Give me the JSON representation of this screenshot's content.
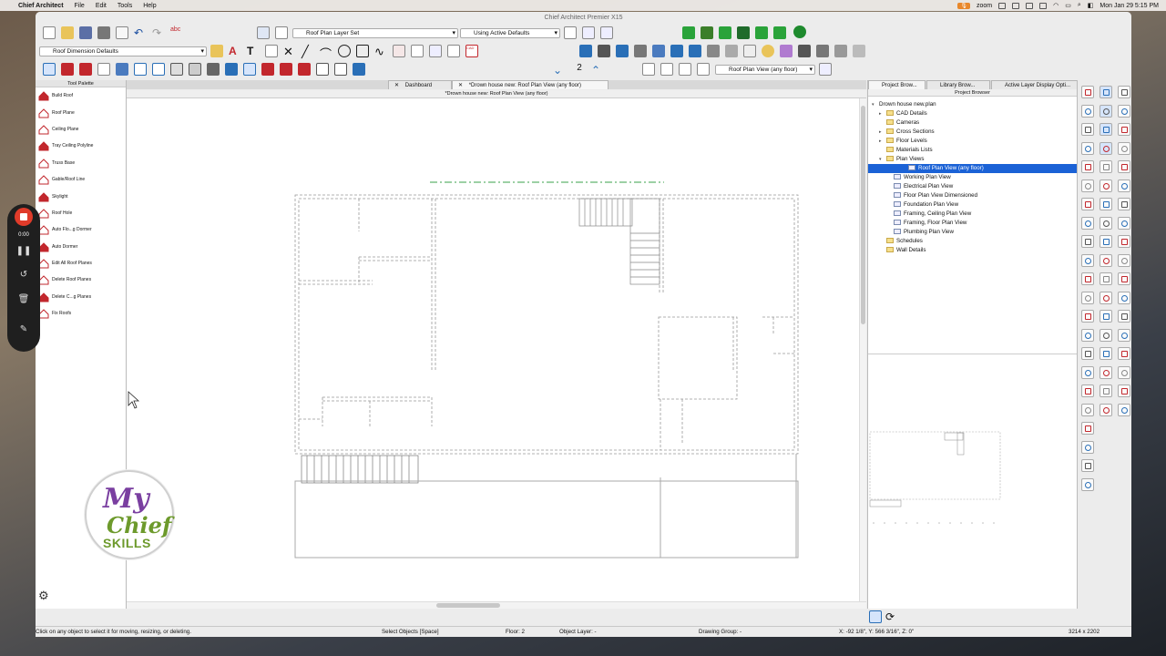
{
  "menubar": {
    "app_name": "Chief Architect",
    "menus": [
      "File",
      "Edit",
      "Tools",
      "Help"
    ],
    "zoom_label": "zoom",
    "clock": "Mon Jan 29  5:15 PM"
  },
  "window": {
    "title": "Chief Architect Premier X15"
  },
  "toolbar": {
    "layer_set": "Roof Plan Layer Set",
    "defaults_mode": "Using Active Defaults",
    "dimension_defaults": "Roof Dimension Defaults",
    "floor_number": "2",
    "view_select": "Roof Plan View (any floor)"
  },
  "palette": {
    "title": "Tool Palette",
    "items": [
      {
        "label": "Build Roof",
        "icon": "build-roof-icon"
      },
      {
        "label": "Roof Plane",
        "icon": "roof-plane-icon"
      },
      {
        "label": "Ceiling Plane",
        "icon": "ceiling-plane-icon"
      },
      {
        "label": "Tray Ceiling Polyline",
        "icon": "tray-ceiling-icon"
      },
      {
        "label": "Truss Base",
        "icon": "truss-base-icon"
      },
      {
        "label": "Gable/Roof Line",
        "icon": "gable-line-icon"
      },
      {
        "label": "Skylight",
        "icon": "skylight-icon"
      },
      {
        "label": "Roof Hole",
        "icon": "roof-hole-icon"
      },
      {
        "label": "Auto Flo...g Dormer",
        "icon": "floating-dormer-icon"
      },
      {
        "label": "Auto Dormer",
        "icon": "auto-dormer-icon"
      },
      {
        "label": "Edit All Roof Planes",
        "icon": "edit-roof-planes-icon"
      },
      {
        "label": "Delete Roof Planes",
        "icon": "delete-roof-planes-icon"
      },
      {
        "label": "Delete C...g Planes",
        "icon": "delete-ceiling-planes-icon"
      },
      {
        "label": "Fix Roofs",
        "icon": "fix-roofs-icon"
      }
    ]
  },
  "tabs": [
    {
      "label": "Dashboard"
    },
    {
      "label": "*Drown house new:  Roof Plan View (any floor)"
    }
  ],
  "view_header": "*Drown house new:  Roof Plan View (any floor)",
  "right_tabs": [
    {
      "label": "Project Brow..."
    },
    {
      "label": "Library Brow..."
    },
    {
      "label": "Active Layer Display Opti..."
    }
  ],
  "project_browser": {
    "title": "Project Browser",
    "root": "Drown house new.plan",
    "nodes": [
      {
        "label": "CAD Details",
        "level": 1,
        "type": "folder",
        "twisty": "▸"
      },
      {
        "label": "Cameras",
        "level": 1,
        "type": "folder",
        "twisty": ""
      },
      {
        "label": "Cross Sections",
        "level": 1,
        "type": "folder",
        "twisty": "▸"
      },
      {
        "label": "Floor Levels",
        "level": 1,
        "type": "folder",
        "twisty": "▸"
      },
      {
        "label": "Materials Lists",
        "level": 1,
        "type": "folder",
        "twisty": ""
      },
      {
        "label": "Plan Views",
        "level": 1,
        "type": "folder",
        "twisty": "▾"
      },
      {
        "label": "Roof Plan View (any floor)",
        "level": 2,
        "type": "view",
        "selected": true
      },
      {
        "label": "Working Plan View",
        "level": 2,
        "type": "view"
      },
      {
        "label": "Electrical Plan View",
        "level": 2,
        "type": "view"
      },
      {
        "label": "Floor Plan View Dimensioned",
        "level": 2,
        "type": "view"
      },
      {
        "label": "Foundation Plan View",
        "level": 2,
        "type": "view"
      },
      {
        "label": "Framing, Ceiling Plan View",
        "level": 2,
        "type": "view"
      },
      {
        "label": "Framing, Floor Plan View",
        "level": 2,
        "type": "view"
      },
      {
        "label": "Plumbing Plan View",
        "level": 2,
        "type": "view"
      },
      {
        "label": "Schedules",
        "level": 1,
        "type": "folder",
        "twisty": ""
      },
      {
        "label": "Wall Details",
        "level": 1,
        "type": "folder",
        "twisty": ""
      }
    ]
  },
  "status": {
    "hint": "Click on any object to select it for moving, resizing, or deleting.",
    "mode": "Select Objects [Space]",
    "floor": "Floor: 2",
    "object_layer": "Object Layer: -",
    "drawing_group": "Drawing Group: -",
    "coords": "X: -92 1/8\", Y: 566 3/16\", Z: 0\"",
    "size": "3214 x 2202"
  },
  "recorder": {
    "time": "0:00"
  },
  "logo": {
    "line1": "My",
    "line2": "Chief",
    "line3": "SKILLS"
  },
  "colors": {
    "accent": "#1b62d6",
    "record": "#e03b2a",
    "roof_red": "#c2272d",
    "logo_purple": "#7a3fa0",
    "logo_green": "#6d9a2c"
  }
}
